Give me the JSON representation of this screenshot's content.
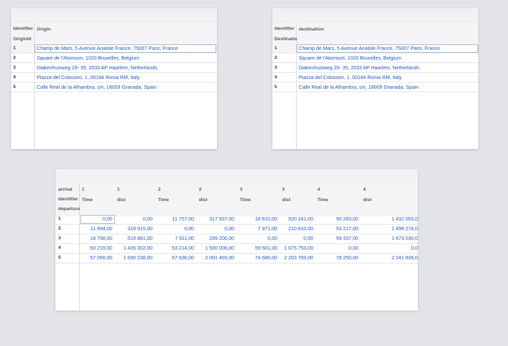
{
  "origin_table": {
    "header": {
      "identifier": "Identifier",
      "column": "Origin",
      "sub_id": "OriginId"
    },
    "row_ids": [
      "1",
      "2",
      "3",
      "4",
      "5"
    ],
    "rows": [
      "Champ de Mars, 5 Avenue Anatole France, 75007 Paris, France",
      "Square de l'Atomium, 1020 Bruxelles, Belgium",
      "Diakenhuisweg 29- 35, 2033 AP Haarlem, Netherlands",
      "Piazza del Colosseo, 1, 00184 Roma RM, Italy",
      "Calle Real de la Alhambra, s/n, 18009 Granada, Spain"
    ]
  },
  "destination_table": {
    "header": {
      "identifier": "Identifier",
      "column": "destination",
      "sub_id": "Destinatio"
    },
    "row_ids": [
      "1",
      "2",
      "3",
      "4",
      "5"
    ],
    "rows": [
      "Champ de Mars, 5 Avenue Anatole France, 75007 Paris, France",
      "Square de l'Atomium, 1020 Bruxelles, Belgium",
      "Diakenhuisweg 29- 35, 2033 AP Haarlem, Netherlands",
      "Piazza del Colosseo, 1, 00184 Roma RM, Italy",
      "Calle Real de la Alhambra, s/n, 18009 Granada, Spain"
    ]
  },
  "matrix_table": {
    "row_header_labels": [
      "arrival",
      "Identifier",
      "departure"
    ],
    "arrival_ids": [
      "1",
      "1",
      "2",
      "2",
      "3",
      "3",
      "4",
      "4"
    ],
    "metric_labels": [
      "Time",
      "dist",
      "Time",
      "dist",
      "Time",
      "dist",
      "Time",
      "dist"
    ],
    "row_ids": [
      "1",
      "2",
      "3",
      "4",
      "5"
    ],
    "rows": [
      [
        "0,00",
        "0,00",
        "11 757,00",
        "317 937,00",
        "18 810,00",
        "520 241,00",
        "50 283,00",
        "1 432 053,0"
      ],
      [
        "11 894,00",
        "319 915,00",
        "0,00",
        "0,00",
        "7 971,00",
        "210 810,00",
        "53 217,00",
        "1 498 274,0"
      ],
      [
        "18 758,00",
        "519 681,00",
        "7 911,00",
        "209 206,00",
        "0,00",
        "0,00",
        "59 337,00",
        "1 673 030,0"
      ],
      [
        "50 219,00",
        "1 435 302,00",
        "53 214,00",
        "1 500 006,00",
        "59 501,00",
        "1 675 753,00",
        "0,00",
        "0,0"
      ],
      [
        "57 056,00",
        "1 690 238,00",
        "67 636,00",
        "2 001 465,00",
        "74 689,00",
        "2 203 769,00",
        "78 250,00",
        "2 241 836,0"
      ]
    ]
  }
}
